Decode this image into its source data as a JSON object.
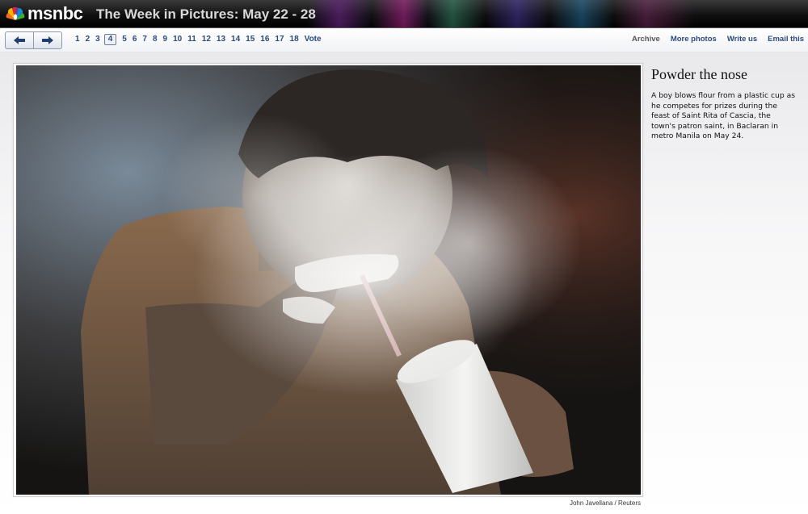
{
  "header": {
    "logo_text": "msnbc",
    "title": "The Week in Pictures: May 22 - 28"
  },
  "nav": {
    "prev_icon": "left-arrow-icon",
    "next_icon": "right-arrow-icon",
    "pages": [
      "1",
      "2",
      "3",
      "4",
      "5",
      "6",
      "7",
      "8",
      "9",
      "10",
      "11",
      "12",
      "13",
      "14",
      "15",
      "16",
      "17",
      "18"
    ],
    "current_page": "4",
    "vote_label": "Vote",
    "links": {
      "archive": "Archive",
      "more_photos": "More photos",
      "write_us": "Write us",
      "email_this": "Email this"
    }
  },
  "photo": {
    "title": "Powder the nose",
    "caption": "A boy blows flour from a plastic cup as he competes for prizes during the feast of Saint Rita of Cascia, the town's patron saint, in Baclaran in metro Manila on May 24.",
    "credit": "John Javellana / Reuters"
  },
  "colors": {
    "link": "#2b4a7c",
    "header_bg": "#101010"
  }
}
